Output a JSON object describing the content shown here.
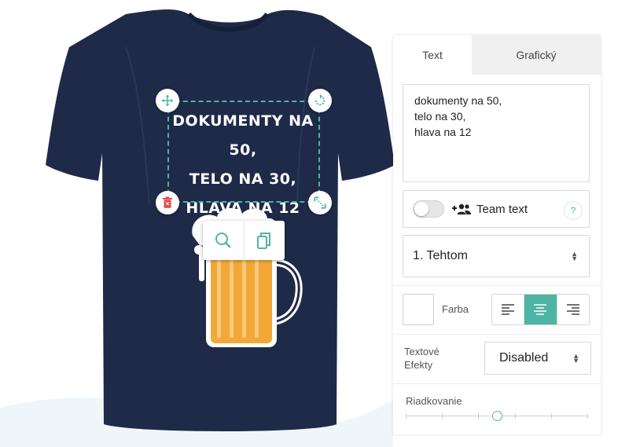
{
  "design": {
    "lines": [
      "DOKUMENTY NA 50,",
      "TELO NA 30,",
      "HLAVA NA 12"
    ]
  },
  "colors": {
    "shirt": "#1e2a48",
    "accent": "#4db5a4",
    "beer": "#f2a838",
    "delete": "#e04a4a"
  },
  "handles": [
    "move-icon",
    "rotate-icon",
    "delete-icon",
    "resize-icon"
  ],
  "floating_tools": [
    "zoom-icon",
    "duplicate-icon"
  ],
  "panel": {
    "tabs": {
      "text": "Text",
      "graphic": "Grafický"
    },
    "textarea": {
      "lines": [
        "dokumenty na 50,",
        "telo na 30,",
        "hlava na 12"
      ]
    },
    "team": {
      "label": "Team text",
      "help": "?",
      "enabled": false
    },
    "font": {
      "selected": "1. Tehtom"
    },
    "color": {
      "label": "Farba",
      "value": "#ffffff"
    },
    "alignment": {
      "options": [
        "left",
        "center",
        "right"
      ],
      "selected": "center"
    },
    "effects": {
      "label_line1": "Textové",
      "label_line2": "Efekty",
      "selected": "Disabled"
    },
    "spacing": {
      "label": "Riadkovanie",
      "value_fraction": 0.5
    }
  }
}
